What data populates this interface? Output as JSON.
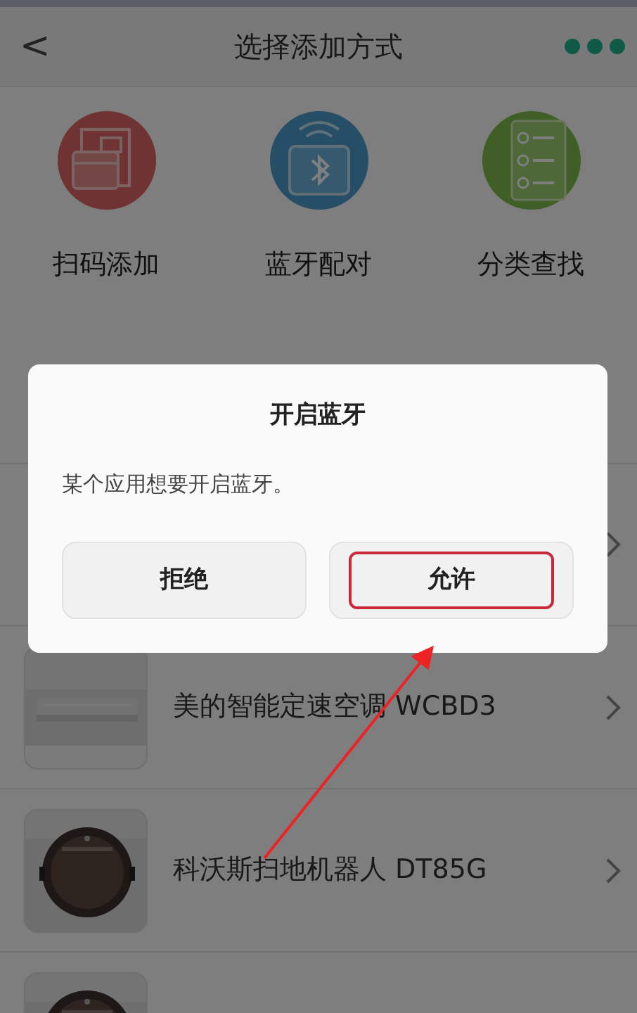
{
  "header": {
    "back": "<",
    "title": "选择添加方式"
  },
  "methods": [
    {
      "kind": "scan",
      "label": "扫码添加"
    },
    {
      "kind": "bluetooth",
      "label": "蓝牙配对"
    },
    {
      "kind": "category",
      "label": "分类查找"
    }
  ],
  "devices": [
    {
      "kind": "picture",
      "name": "美的智能定速空调 WCBD3"
    },
    {
      "kind": "picture",
      "name": "科沃斯扫地机器人 DT85G"
    },
    {
      "kind": "picture"
    }
  ],
  "dialog": {
    "title": "开启蓝牙",
    "message": "某个应用想要开启蓝牙。",
    "buttons": [
      {
        "label": "拒绝",
        "highlighted": false
      },
      {
        "label": "允许",
        "highlighted": true
      }
    ]
  }
}
